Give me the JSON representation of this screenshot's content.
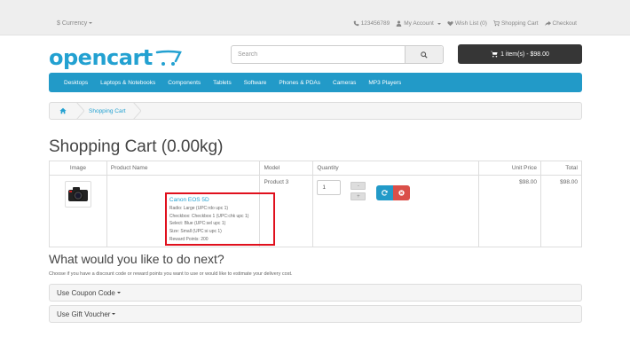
{
  "topbar": {
    "currency_label": "$ Currency",
    "phone": "123456789",
    "my_account": "My Account",
    "wishlist": "Wish List (0)",
    "shopping_cart": "Shopping Cart",
    "checkout": "Checkout"
  },
  "header": {
    "logo_text": "opencart",
    "search_placeholder": "Search",
    "cart_button": "1 item(s) - $98.00"
  },
  "menu": {
    "items": [
      "Desktops",
      "Laptops & Notebooks",
      "Components",
      "Tablets",
      "Software",
      "Phones & PDAs",
      "Cameras",
      "MP3 Players"
    ]
  },
  "breadcrumb": {
    "current": "Shopping Cart"
  },
  "page_title": "Shopping Cart  (0.00kg)",
  "table": {
    "headers": [
      "Image",
      "Product Name",
      "Model",
      "Quantity",
      "Unit Price",
      "Total"
    ],
    "row": {
      "product_name": "Canon EOS 5D",
      "options": [
        "Radio: Large (UPC:rdo upc 1)",
        "Checkbox: Checkbox 1 (UPC:chk upc 1)",
        "Select: Blue (UPC:sel upc 1)",
        "Size: Small (UPC:si upc 1)",
        "Reward Points: 200"
      ],
      "model": "Product 3",
      "quantity": "1",
      "unit_price": "$98.00",
      "total": "$98.00"
    }
  },
  "next": {
    "title": "What would you like to do next?",
    "description": "Choose if you have a discount code or reward points you want to use or would like to estimate your delivery cost.",
    "coupon": "Use Coupon Code",
    "voucher": "Use Gift Voucher"
  },
  "colors": {
    "brand_blue": "#23a1d1",
    "menu_blue": "#229ac8",
    "highlight_red": "#e0101d",
    "remove_red": "#da4f49",
    "cart_dark": "#363636"
  }
}
